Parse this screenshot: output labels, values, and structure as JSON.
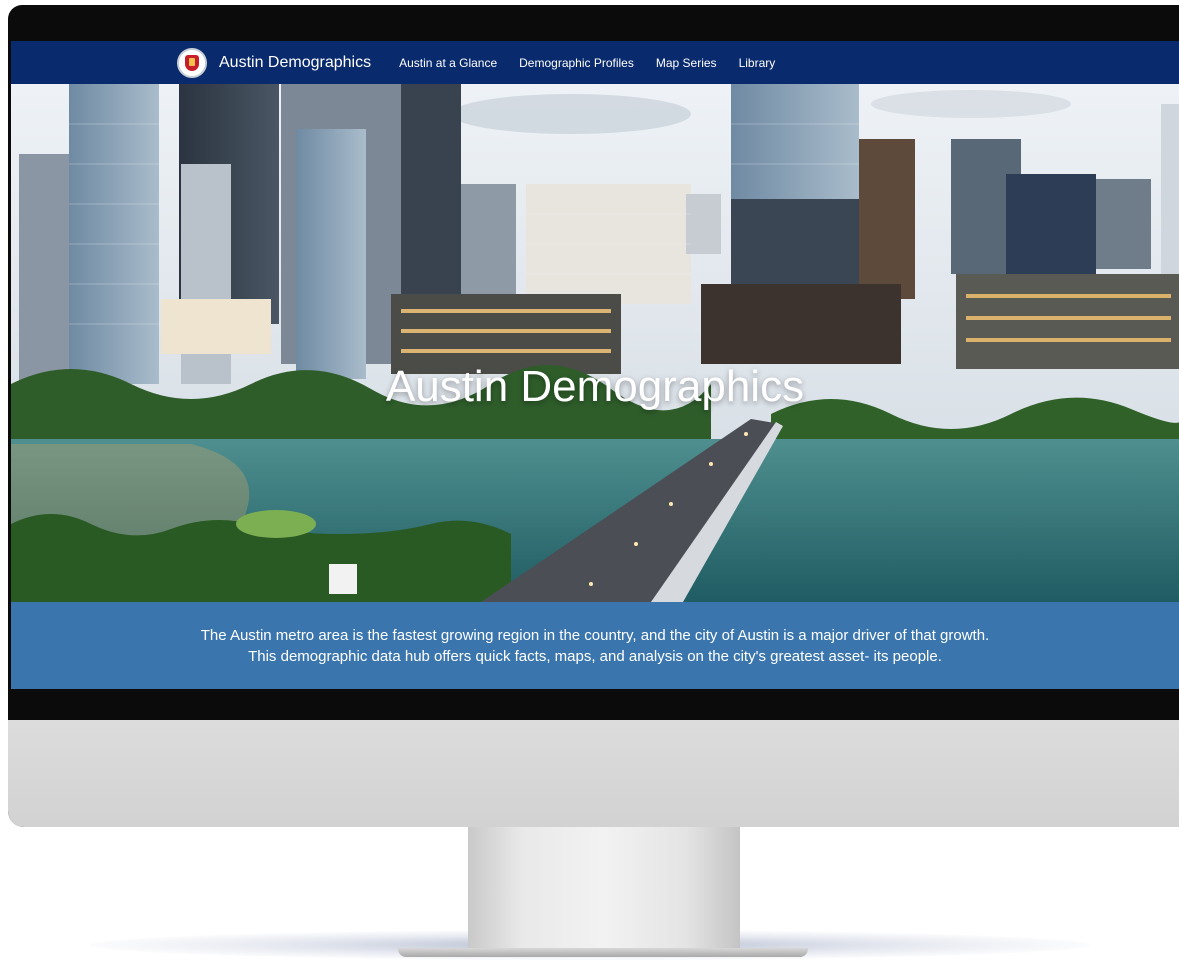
{
  "site": {
    "brand_title": "Austin Demographics",
    "logo_icon": "city-seal-icon"
  },
  "nav": {
    "items": [
      {
        "label": "Austin at a Glance"
      },
      {
        "label": "Demographic Profiles"
      },
      {
        "label": "Map Series"
      },
      {
        "label": "Library"
      }
    ]
  },
  "hero": {
    "title": "Austin Demographics"
  },
  "info": {
    "line1": "The Austin metro area is the fastest growing region in the country, and the city of Austin is a major driver of that growth.",
    "line2": "This demographic data hub offers quick facts, maps, and analysis on the city's greatest asset- its people."
  },
  "colors": {
    "navbar": "#0a2a6e",
    "info_bar": "#3a76ad",
    "monitor_bezel": "#0b0b0b",
    "monitor_chin": "#d6d6d6"
  }
}
